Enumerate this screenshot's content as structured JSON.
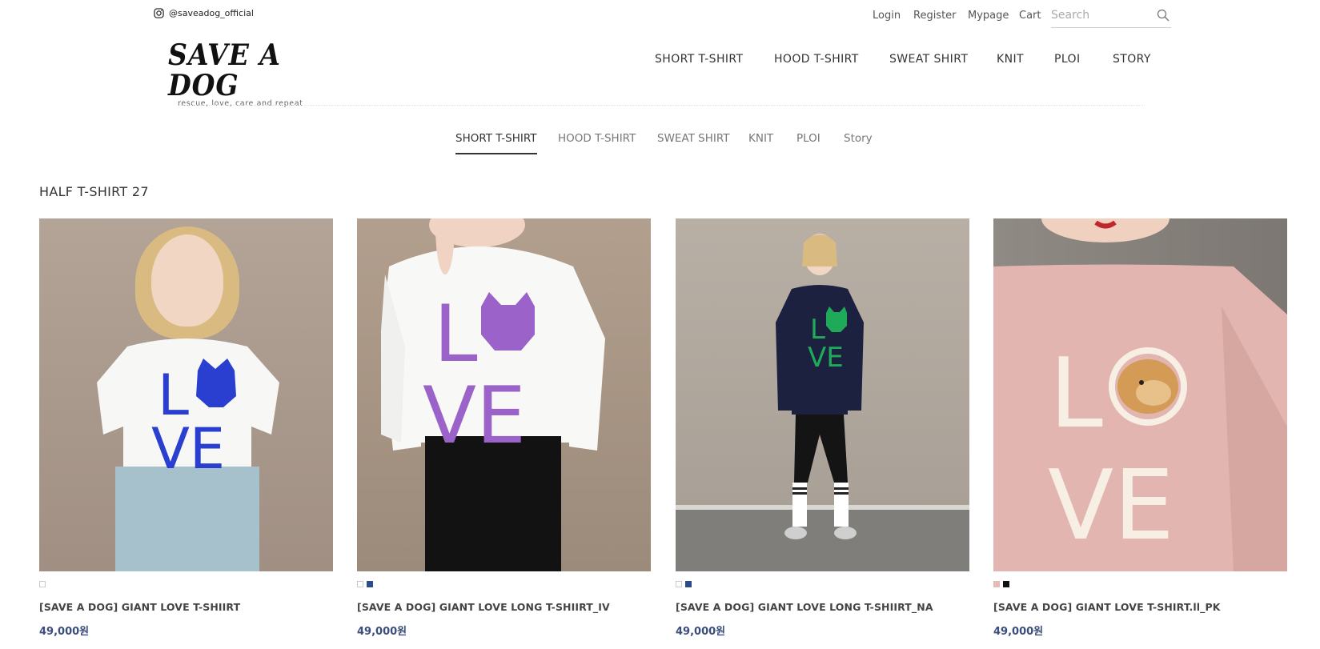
{
  "topbar": {
    "instagram_handle": "@saveadog_official",
    "login": "Login",
    "register": "Register",
    "mypage": "Mypage",
    "cart": "Cart",
    "search_placeholder": "Search"
  },
  "logo": {
    "wordmark": "SAVE A DOG",
    "tagline": "rescue, love, care and repeat"
  },
  "main_nav": [
    "SHORT T-SHIRT",
    "HOOD T-SHIRT",
    "SWEAT SHIRT",
    "KNIT",
    "PLOI",
    "STORY"
  ],
  "sub_nav": [
    "SHORT T-SHIRT",
    "HOOD T-SHIRT",
    "SWEAT SHIRT",
    "KNIT",
    "PLOI",
    "Story"
  ],
  "sub_nav_active": "SHORT T-SHIRT",
  "category": {
    "title": "HALF T-SHIRT 27"
  },
  "products": [
    {
      "name": "[SAVE A DOG] GIANT LOVE T-SHIIRT",
      "price": "49,000원",
      "swatches": [
        "#ffffff"
      ],
      "shirt_color": "#f7f7f5",
      "print_color": "#2a3fd0",
      "bg_color": "#a9998c"
    },
    {
      "name": "[SAVE A DOG] GIANT LOVE LONG T-SHIIRT_IV",
      "price": "49,000원",
      "swatches": [
        "#ffffff",
        "#2f4a8a"
      ],
      "shirt_color": "#f8f8f6",
      "print_color": "#9b63c9",
      "bg_color": "#aa9685"
    },
    {
      "name": "[SAVE A DOG] GIANT LOVE LONG T-SHIIRT_NA",
      "price": "49,000원",
      "swatches": [
        "#ffffff",
        "#2f4a8a"
      ],
      "shirt_color": "#1d2140",
      "print_color": "#1faa5a",
      "bg_color": "#b3aa9f"
    },
    {
      "name": "[SAVE A DOG] GIANT LOVE T-SHIRT.ll_PK",
      "price": "49,000원",
      "swatches": [
        "#e6b8b8",
        "#111111"
      ],
      "shirt_color": "#e2b5b0",
      "print_color": "#f7efe3",
      "bg_color": "#8c8883"
    }
  ],
  "colors": {
    "price": "#3b4d7a",
    "text": "#333333"
  }
}
